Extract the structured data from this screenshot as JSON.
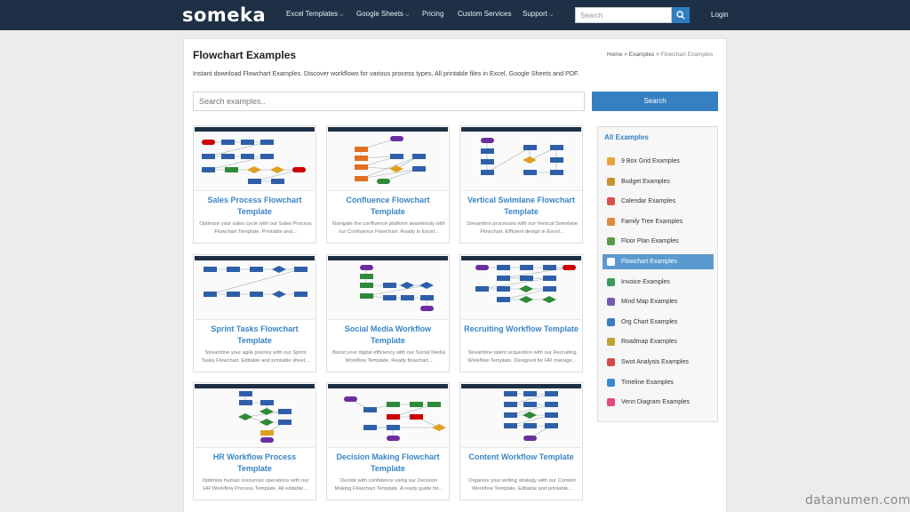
{
  "header": {
    "logo": "someka",
    "nav": [
      {
        "label": "Excel Templates",
        "has_menu": true
      },
      {
        "label": "Google Sheets",
        "has_menu": true
      },
      {
        "label": "Pricing",
        "has_menu": false
      },
      {
        "label": "Custom Services",
        "has_menu": false
      },
      {
        "label": "Support",
        "has_menu": true
      }
    ],
    "search_placeholder": "Search",
    "login": "Login"
  },
  "page": {
    "title": "Flowchart Examples",
    "breadcrumb": [
      "Home",
      "Examples",
      "Flowchart Examples"
    ],
    "breadcrumb_sep": ">",
    "intro": "Instant download Flowchart Examples. Discover workflows for various process types. All printable files in Excel, Google Sheets and PDF.",
    "search_placeholder": "Search examples..",
    "search_button": "Search"
  },
  "cards": [
    {
      "title": "Sales Process Flowchart Template",
      "desc": "Optimize your sales cycle with our Sales Process Flowchart Template. Printable and..."
    },
    {
      "title": "Confluence Flowchart Template",
      "desc": "Navigate the confluence platform seamlessly with our Confluence Flowchart. Ready in Excel..."
    },
    {
      "title": "Vertical Swimlane Flowchart Template",
      "desc": "Streamline processes with our Vertical Swimlane Flowchart. Efficient design in Excel..."
    },
    {
      "title": "Sprint Tasks Flowchart Template",
      "desc": "Streamline your agile journey with our Sprint Tasks Flowchart. Editable and printable sheet..."
    },
    {
      "title": "Social Media Workflow Template",
      "desc": "Boost your digital efficiency with our Social Media Workflow Template. Ready flowchart..."
    },
    {
      "title": "Recruiting Workflow Template",
      "desc": "Streamline talent acquisition with our Recruiting Workflow Template. Designed for HR manage..."
    },
    {
      "title": "HR Workflow Process Template",
      "desc": "Optimize human resources operations with our HR Workflow Process Template. All editable..."
    },
    {
      "title": "Decision Making Flowchart Template",
      "desc": "Decide with confidence using our Decision Making Flowchart Template. A ready guide for..."
    },
    {
      "title": "Content Workflow Template",
      "desc": "Organize your writing strategy with our Content Workflow Template. Editable and printable..."
    }
  ],
  "sidebar": {
    "heading": "All Examples",
    "items": [
      {
        "label": "9 Box Grid Examples",
        "icon": "grid-icon",
        "color": "#e8a33a"
      },
      {
        "label": "Budget Examples",
        "icon": "money-bag-icon",
        "color": "#c8932e"
      },
      {
        "label": "Calendar Examples",
        "icon": "calendar-icon",
        "color": "#d9534f"
      },
      {
        "label": "Family Tree Examples",
        "icon": "family-tree-icon",
        "color": "#e08b3a"
      },
      {
        "label": "Floor Plan Examples",
        "icon": "house-icon",
        "color": "#5b9a4a"
      },
      {
        "label": "Flowchart Examples",
        "icon": "flowchart-icon",
        "color": "#ffffff",
        "active": true
      },
      {
        "label": "Invoice Examples",
        "icon": "invoice-icon",
        "color": "#3c9a5a"
      },
      {
        "label": "Mind Map Examples",
        "icon": "mind-map-icon",
        "color": "#7a5ab0"
      },
      {
        "label": "Org Chart Examples",
        "icon": "org-chart-icon",
        "color": "#3a7ac0"
      },
      {
        "label": "Roadmap Examples",
        "icon": "roadmap-icon",
        "color": "#c0a030"
      },
      {
        "label": "Swot Analysis Examples",
        "icon": "swot-icon",
        "color": "#d04a4a"
      },
      {
        "label": "Timeline Examples",
        "icon": "timeline-icon",
        "color": "#3a8ad0"
      },
      {
        "label": "Venn Diagram Examples",
        "icon": "venn-icon",
        "color": "#e04a7a"
      }
    ]
  },
  "watermark": "datanumen.com"
}
